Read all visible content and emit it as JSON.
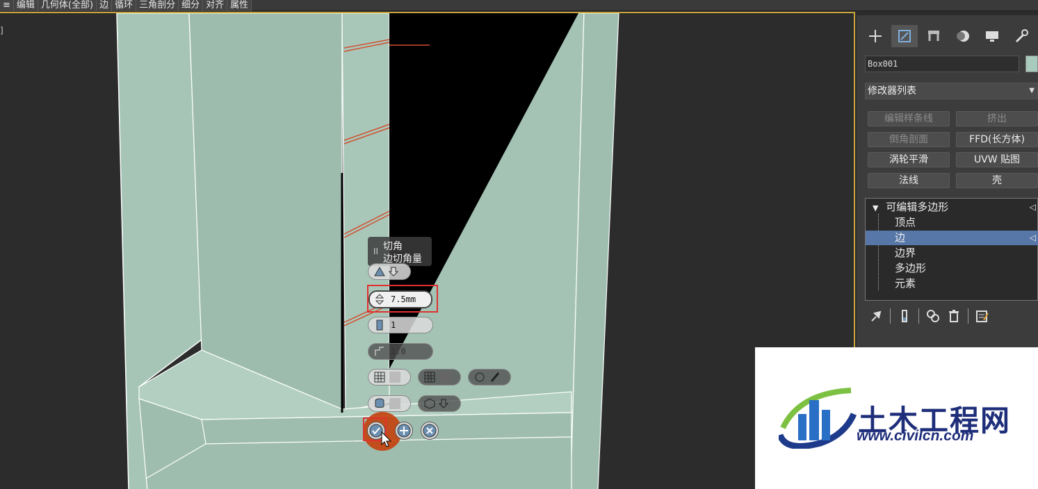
{
  "menu": {
    "items": [
      "编辑",
      "几何体(全部)",
      "边",
      "循环",
      "三角剖分",
      "细分",
      "对齐",
      "属性"
    ]
  },
  "viewport": {
    "label": "]"
  },
  "caddy": {
    "title": "切角",
    "subtitle": "边切角量",
    "amount": "7.5mm",
    "segments": "1",
    "tension": "1.0",
    "grip": "II"
  },
  "panel": {
    "tabs": [
      "create-icon",
      "modify-icon",
      "hierarchy-icon",
      "motion-icon",
      "display-icon",
      "utilities-icon"
    ],
    "object_name": "Box001",
    "object_color": "#a9cbbd",
    "modifier_list": "修改器列表",
    "modifier_buttons": [
      "编辑样条线",
      "挤出",
      "倒角剖面",
      "FFD(长方体)",
      "涡轮平滑",
      "UVW 贴图",
      "法线",
      "壳"
    ],
    "stack_root": "可编辑多边形",
    "stack_items": [
      "顶点",
      "边",
      "边界",
      "多边形",
      "元素"
    ]
  },
  "watermark": {
    "cn": "土木工程网",
    "url": "www.civilcn.com"
  },
  "colors": {
    "accent": "#c8a43a",
    "selection": "#5677a8",
    "highlight_red": "#e03030",
    "model": "#a3c2b4"
  }
}
